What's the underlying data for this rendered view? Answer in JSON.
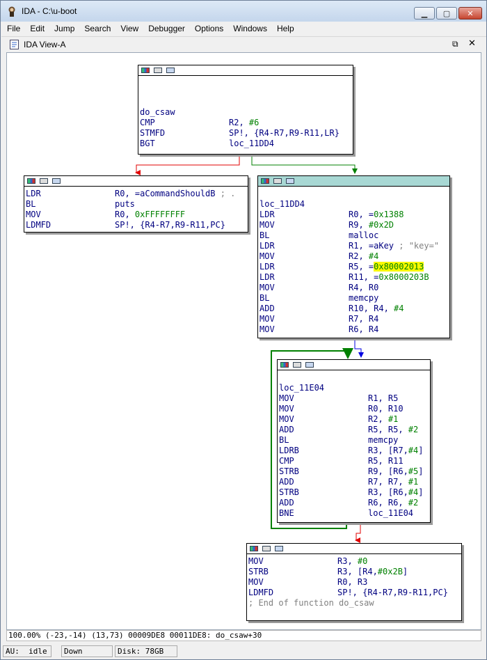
{
  "window": {
    "title": "IDA - C:\\u-boot"
  },
  "menu": [
    "File",
    "Edit",
    "Jump",
    "Search",
    "View",
    "Debugger",
    "Options",
    "Windows",
    "Help"
  ],
  "view_tab": {
    "label": "IDA View-A"
  },
  "nodes": {
    "top": {
      "lines": [
        {
          "label": "do_csaw"
        },
        {
          "m": "CMP",
          "o": [
            {
              "t": "R2, "
            },
            {
              "t": "#6",
              "c": "num"
            }
          ]
        },
        {
          "m": "STMFD",
          "o": [
            {
              "t": "SP!, {R4-R7,R9-R11,LR}"
            }
          ]
        },
        {
          "m": "BGT",
          "o": [
            {
              "t": "loc_11DD4"
            }
          ]
        }
      ]
    },
    "left": {
      "lines": [
        {
          "m": "LDR",
          "o": [
            {
              "t": "R0, =aCommandShouldB "
            },
            {
              "t": "; .",
              "c": "cmt"
            }
          ]
        },
        {
          "m": "BL",
          "o": [
            {
              "t": "puts"
            }
          ]
        },
        {
          "m": "MOV",
          "o": [
            {
              "t": "R0, "
            },
            {
              "t": "0xFFFFFFFF",
              "c": "num"
            }
          ]
        },
        {
          "m": "LDMFD",
          "o": [
            {
              "t": "SP!, {R4-R7,R9-R11,PC}"
            }
          ]
        }
      ]
    },
    "right": {
      "lines": [
        {
          "label": "loc_11DD4"
        },
        {
          "m": "LDR",
          "o": [
            {
              "t": "R0, ="
            },
            {
              "t": "0x1388",
              "c": "num"
            }
          ]
        },
        {
          "m": "MOV",
          "o": [
            {
              "t": "R9, "
            },
            {
              "t": "#0x2D",
              "c": "num"
            }
          ]
        },
        {
          "m": "BL",
          "o": [
            {
              "t": "malloc"
            }
          ]
        },
        {
          "m": "LDR",
          "o": [
            {
              "t": "R1, =aKey "
            },
            {
              "t": "; \"key=\"",
              "c": "cmt"
            }
          ]
        },
        {
          "m": "MOV",
          "o": [
            {
              "t": "R2, "
            },
            {
              "t": "#4",
              "c": "num"
            }
          ]
        },
        {
          "m": "LDR",
          "o": [
            {
              "t": "R5, ="
            },
            {
              "t": "0x80002013",
              "c": "hl"
            }
          ]
        },
        {
          "m": "LDR",
          "o": [
            {
              "t": "R11, ="
            },
            {
              "t": "0x8000203B",
              "c": "num"
            }
          ]
        },
        {
          "m": "MOV",
          "o": [
            {
              "t": "R4, R0"
            }
          ]
        },
        {
          "m": "BL",
          "o": [
            {
              "t": "memcpy"
            }
          ]
        },
        {
          "m": "ADD",
          "o": [
            {
              "t": "R10, R4, "
            },
            {
              "t": "#4",
              "c": "num"
            }
          ]
        },
        {
          "m": "MOV",
          "o": [
            {
              "t": "R7, R4"
            }
          ]
        },
        {
          "m": "MOV",
          "o": [
            {
              "t": "R6, R4"
            }
          ]
        }
      ]
    },
    "loop": {
      "lines": [
        {
          "label": "loc_11E04"
        },
        {
          "m": "MOV",
          "o": [
            {
              "t": "R1, R5"
            }
          ]
        },
        {
          "m": "MOV",
          "o": [
            {
              "t": "R0, R10"
            }
          ]
        },
        {
          "m": "MOV",
          "o": [
            {
              "t": "R2, "
            },
            {
              "t": "#1",
              "c": "num"
            }
          ]
        },
        {
          "m": "ADD",
          "o": [
            {
              "t": "R5, R5, "
            },
            {
              "t": "#2",
              "c": "num"
            }
          ]
        },
        {
          "m": "BL",
          "o": [
            {
              "t": "memcpy"
            }
          ]
        },
        {
          "m": "LDRB",
          "o": [
            {
              "t": "R3, [R7,"
            },
            {
              "t": "#4",
              "c": "num"
            },
            {
              "t": "]"
            }
          ]
        },
        {
          "m": "CMP",
          "o": [
            {
              "t": "R5, R11"
            }
          ]
        },
        {
          "m": "STRB",
          "o": [
            {
              "t": "R9, [R6,"
            },
            {
              "t": "#5",
              "c": "num"
            },
            {
              "t": "]"
            }
          ]
        },
        {
          "m": "ADD",
          "o": [
            {
              "t": "R7, R7, "
            },
            {
              "t": "#1",
              "c": "num"
            }
          ]
        },
        {
          "m": "STRB",
          "o": [
            {
              "t": "R3, [R6,"
            },
            {
              "t": "#4",
              "c": "num"
            },
            {
              "t": "]"
            }
          ]
        },
        {
          "m": "ADD",
          "o": [
            {
              "t": "R6, R6, "
            },
            {
              "t": "#2",
              "c": "num"
            }
          ]
        },
        {
          "m": "BNE",
          "o": [
            {
              "t": "loc_11E04"
            }
          ]
        }
      ]
    },
    "bottom": {
      "lines": [
        {
          "m": "MOV",
          "o": [
            {
              "t": "R3, "
            },
            {
              "t": "#0",
              "c": "num"
            }
          ]
        },
        {
          "m": "STRB",
          "o": [
            {
              "t": "R3, [R4,"
            },
            {
              "t": "#0x2B",
              "c": "num"
            },
            {
              "t": "]"
            }
          ]
        },
        {
          "m": "MOV",
          "o": [
            {
              "t": "R0, R3"
            }
          ]
        },
        {
          "m": "LDMFD",
          "o": [
            {
              "t": "SP!, {R4-R7,R9-R11,PC}"
            }
          ]
        },
        {
          "comment": "; End of function do_csaw"
        }
      ]
    }
  },
  "status": {
    "line1": "100.00% (-23,-14) (13,73) 00009DE8 00011DE8: do_csaw+30",
    "au_label": "AU:",
    "au_state": "idle",
    "direction": "Down",
    "disk": "Disk: 78GB"
  },
  "colors": {
    "edge_true": "#008000",
    "edge_false": "#e00000",
    "edge_uncond": "#0000e0",
    "mnemonic": "#000080",
    "immediate": "#008000",
    "highlight": "#f8f800"
  }
}
